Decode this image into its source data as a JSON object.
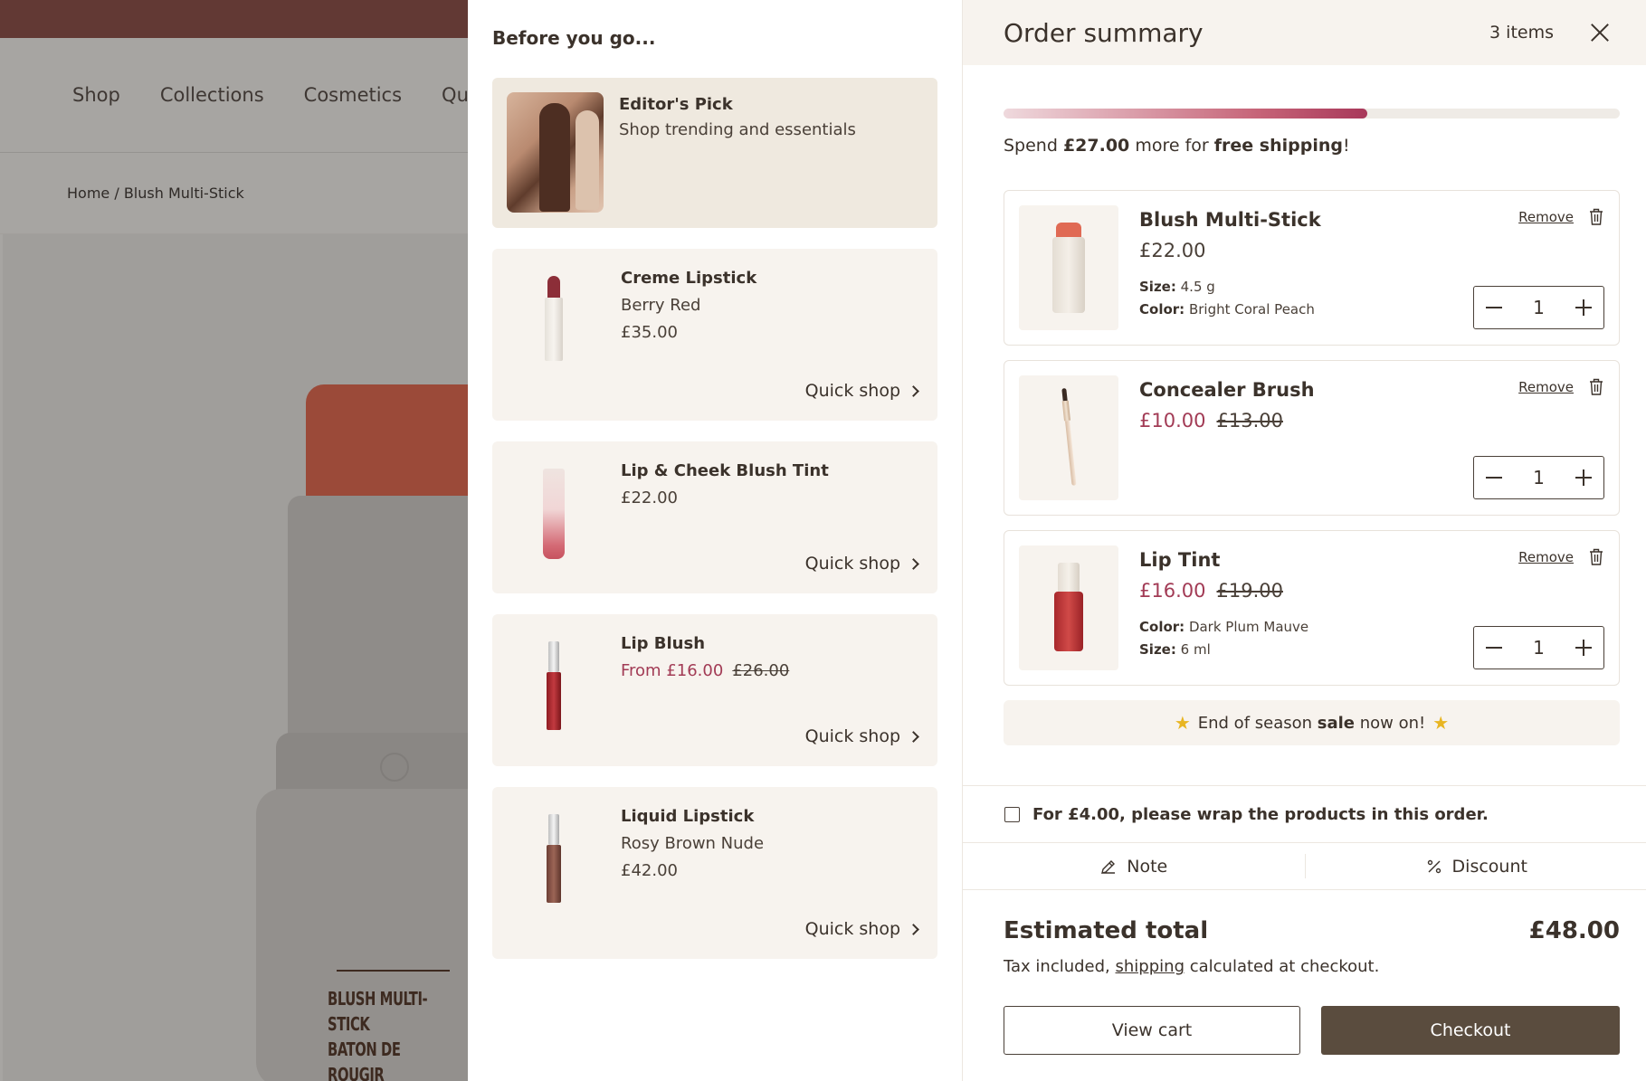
{
  "background": {
    "nav": [
      "Shop",
      "Collections",
      "Cosmetics",
      "Quiz"
    ],
    "breadcrumb": "Home / Blush Multi-Stick",
    "hero_label_line1": "BLUSH MULTI-STICK",
    "hero_label_line2": "BATON DE ROUGIR"
  },
  "upsell": {
    "title": "Before you go...",
    "editor": {
      "title": "Editor's Pick",
      "subtitle": "Shop trending and essentials"
    },
    "quick_shop_label": "Quick shop",
    "products": [
      {
        "name": "Creme Lipstick",
        "variant": "Berry Red",
        "price": "£35.00"
      },
      {
        "name": "Lip & Cheek Blush Tint",
        "price": "£22.00"
      },
      {
        "name": "Lip Blush",
        "sale_price": "From £16.00",
        "compare_price": "£26.00"
      },
      {
        "name": "Liquid Lipstick",
        "variant": "Rosy Brown Nude",
        "price": "£42.00"
      }
    ]
  },
  "summary": {
    "title": "Order summary",
    "count": "3 items",
    "shipping_progress": 0.59,
    "shipping": {
      "pre": "Spend ",
      "amount": "£27.00",
      "mid": " more for ",
      "highlight": "free shipping",
      "post": "!"
    },
    "remove_label": "Remove",
    "items": [
      {
        "name": "Blush Multi-Stick",
        "price": "£22.00",
        "meta": [
          {
            "key": "Size:",
            "value": "4.5 g"
          },
          {
            "key": "Color:",
            "value": "Bright Coral Peach"
          }
        ],
        "qty": "1"
      },
      {
        "name": "Concealer Brush",
        "sale_price": "£10.00",
        "compare_price": "£13.00",
        "qty": "1"
      },
      {
        "name": "Lip Tint",
        "sale_price": "£16.00",
        "compare_price": "£19.00",
        "meta": [
          {
            "key": "Color:",
            "value": "Dark Plum Mauve"
          },
          {
            "key": "Size:",
            "value": "6 ml"
          }
        ],
        "qty": "1"
      }
    ],
    "sale_banner": {
      "pre": "End of season ",
      "bold": "sale",
      "post": " now on!"
    },
    "gift_wrap_label": "For £4.00, please wrap the products in this order.",
    "note_label": "Note",
    "discount_label": "Discount",
    "total_label": "Estimated total",
    "total_value": "£48.00",
    "tax_note": {
      "pre": "Tax included, ",
      "link": "shipping",
      "post": " calculated at checkout."
    },
    "view_cart_label": "View cart",
    "checkout_label": "Checkout"
  }
}
